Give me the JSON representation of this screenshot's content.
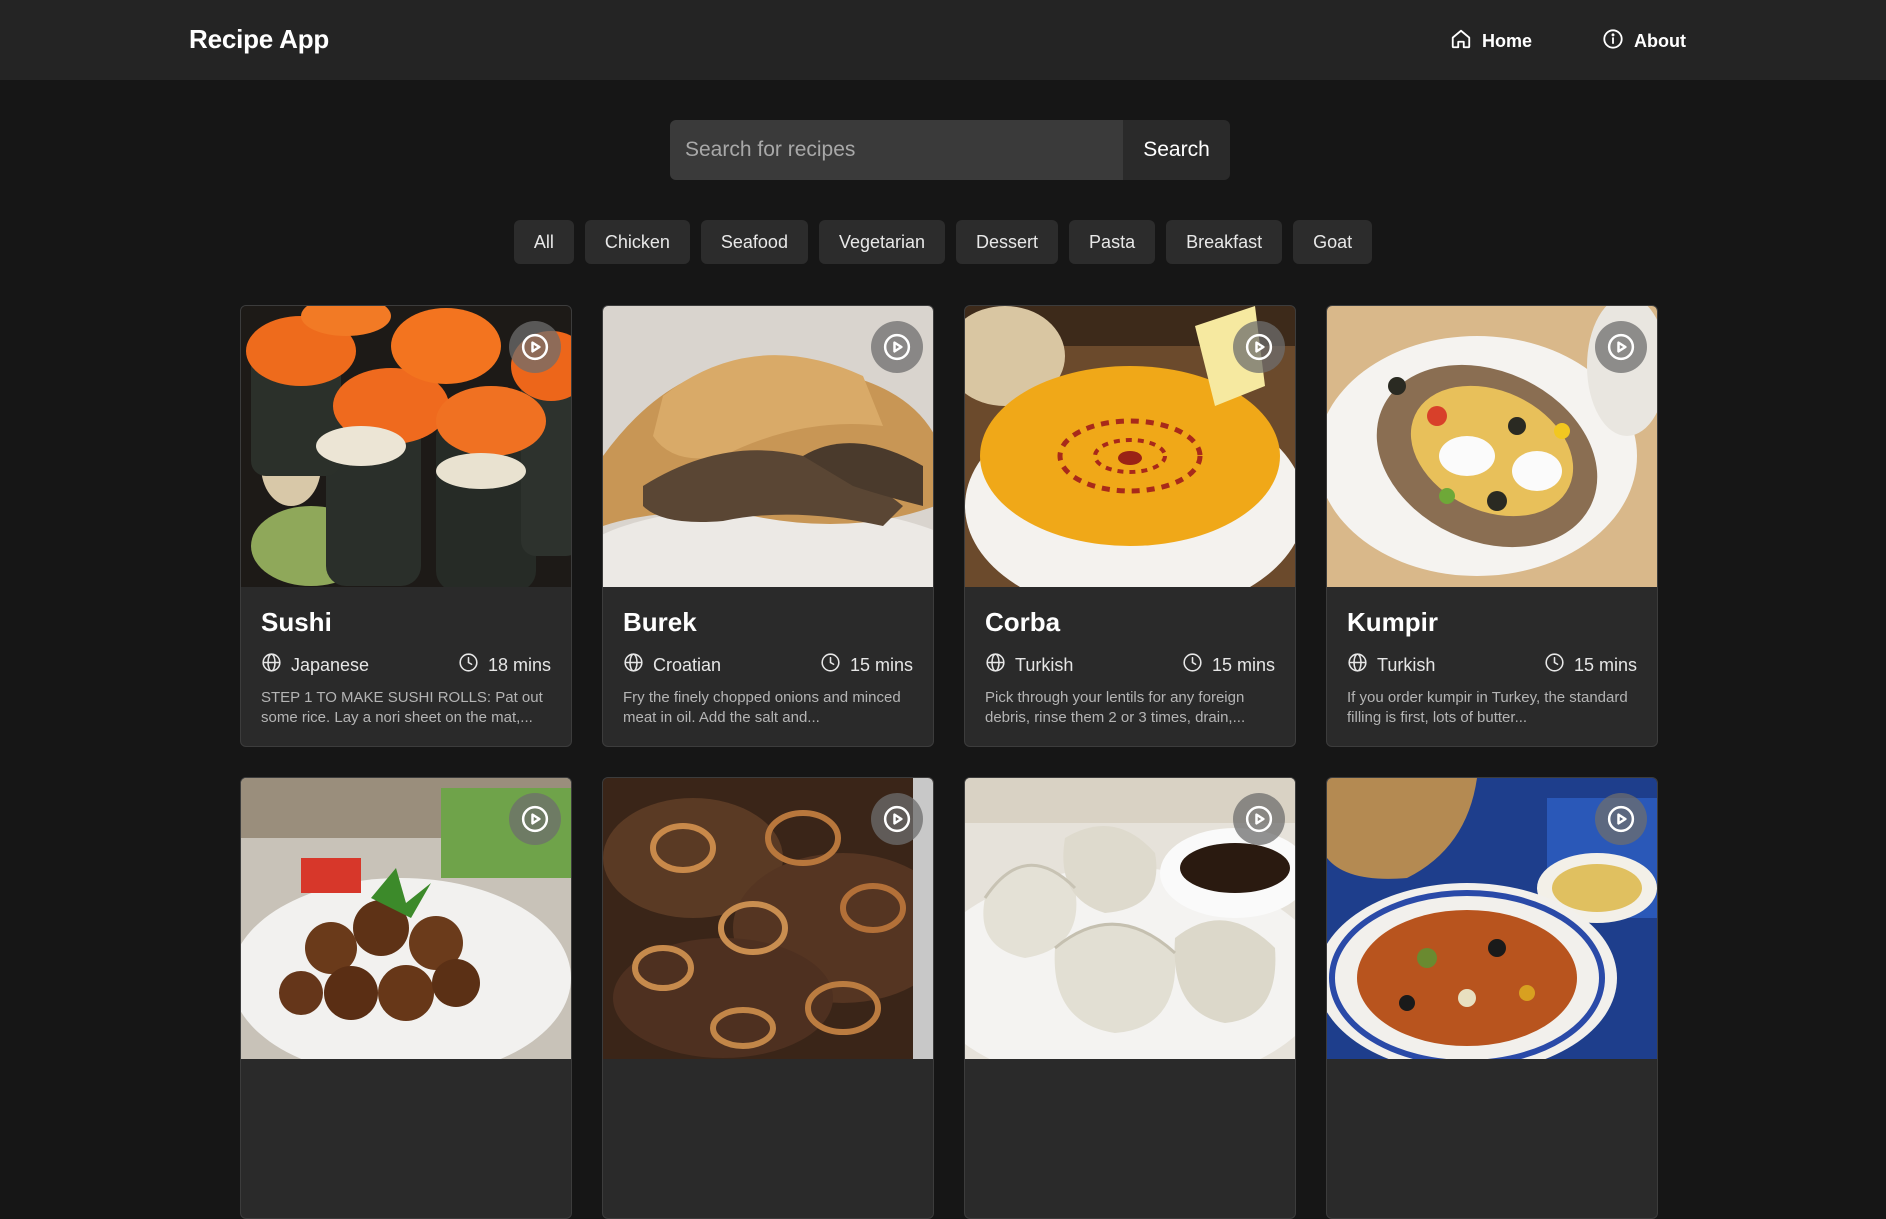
{
  "app": {
    "title": "Recipe App",
    "nav": [
      {
        "label": "Home",
        "icon": "home-icon"
      },
      {
        "label": "About",
        "icon": "info-icon"
      }
    ]
  },
  "search": {
    "placeholder": "Search for recipes",
    "value": "",
    "button_label": "Search"
  },
  "categories": [
    "All",
    "Chicken",
    "Seafood",
    "Vegetarian",
    "Dessert",
    "Pasta",
    "Breakfast",
    "Goat"
  ],
  "recipes": [
    {
      "name": "Sushi",
      "cuisine": "Japanese",
      "time": "18 mins",
      "description": "STEP 1 TO MAKE SUSHI ROLLS: Pat out some rice. Lay a nori sheet on the mat,...",
      "image": "sushi"
    },
    {
      "name": "Burek",
      "cuisine": "Croatian",
      "time": "15 mins",
      "description": "Fry the finely chopped onions and minced meat in oil. Add the salt and...",
      "image": "burek"
    },
    {
      "name": "Corba",
      "cuisine": "Turkish",
      "time": "15 mins",
      "description": "Pick through your lentils for any foreign debris, rinse them 2 or 3 times, drain,...",
      "image": "corba"
    },
    {
      "name": "Kumpir",
      "cuisine": "Turkish",
      "time": "15 mins",
      "description": "If you order kumpir in Turkey, the standard filling is first, lots of butter...",
      "image": "kumpir"
    },
    {
      "name": "",
      "cuisine": "",
      "time": "",
      "description": "",
      "image": "falafel"
    },
    {
      "name": "",
      "cuisine": "",
      "time": "",
      "description": "",
      "image": "beef-onions"
    },
    {
      "name": "",
      "cuisine": "",
      "time": "",
      "description": "",
      "image": "dumplings"
    },
    {
      "name": "",
      "cuisine": "",
      "time": "",
      "description": "",
      "image": "stew"
    }
  ],
  "colors": {
    "background": "#161616",
    "navbar": "#242424",
    "card": "#2a2a2a",
    "chip": "#2c2c2c",
    "input": "#3a3a3a"
  }
}
